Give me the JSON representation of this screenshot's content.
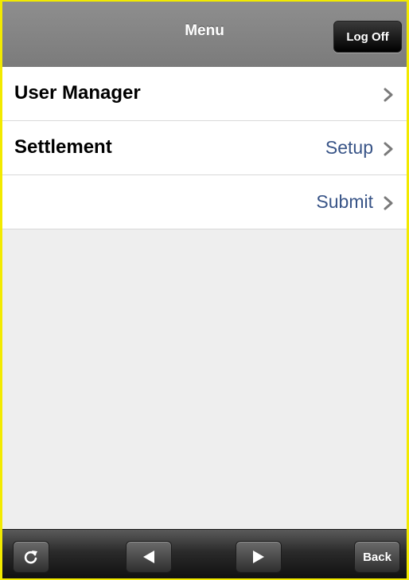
{
  "header": {
    "title": "Menu",
    "logoff_label": "Log Off"
  },
  "list": {
    "rows": [
      {
        "label": "User Manager",
        "detail": ""
      },
      {
        "label": "Settlement",
        "detail": "Setup"
      },
      {
        "label": "",
        "detail": "Submit"
      }
    ]
  },
  "toolbar": {
    "refresh_icon": "refresh-icon",
    "prev_icon": "arrow-left-icon",
    "next_icon": "arrow-right-icon",
    "back_label": "Back"
  },
  "colors": {
    "frame_border": "#f2ea00",
    "navbar": "#858585",
    "detail_text": "#385487",
    "background": "#eeeeee"
  }
}
